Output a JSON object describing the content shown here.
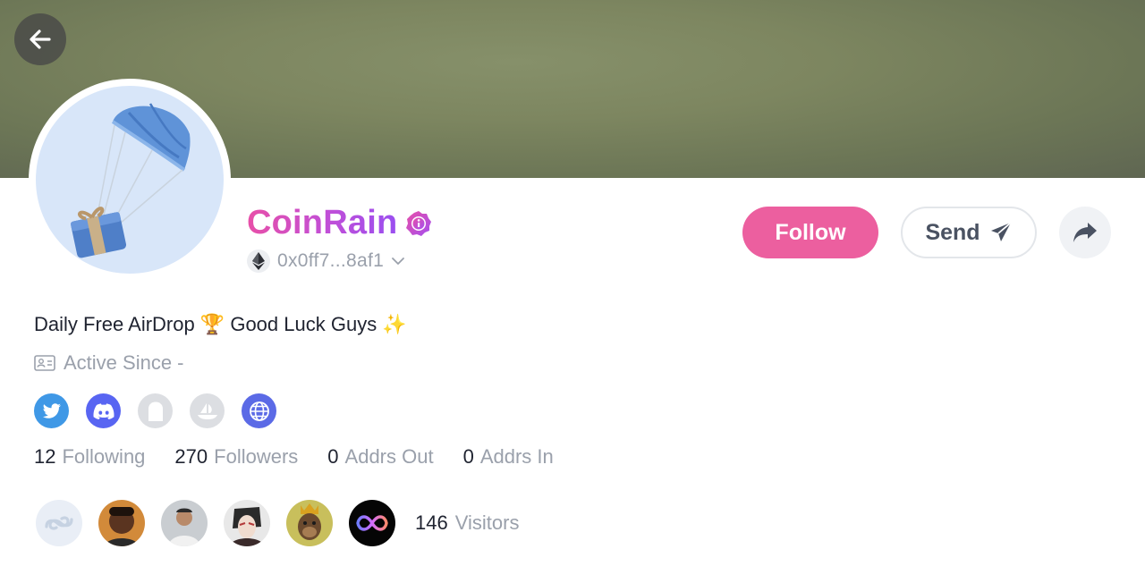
{
  "profile": {
    "name": "CoinRain",
    "address": "0x0ff7...8af1",
    "bio": "Daily Free AirDrop 🏆 Good Luck Guys ✨",
    "active_since": "Active Since -"
  },
  "actions": {
    "follow_label": "Follow",
    "send_label": "Send"
  },
  "socials": [
    {
      "icon": "twitter-icon",
      "color": "#3f98e6"
    },
    {
      "icon": "discord-icon",
      "color": "#5865f2"
    },
    {
      "icon": "ghost-icon",
      "color": "#dcdee2"
    },
    {
      "icon": "opensea-icon",
      "color": "#dcdee2"
    },
    {
      "icon": "globe-icon",
      "color": "#5b6ae6"
    }
  ],
  "stats": [
    {
      "value": "12",
      "label": "Following"
    },
    {
      "value": "270",
      "label": "Followers"
    },
    {
      "value": "0",
      "label": "Addrs Out"
    },
    {
      "value": "0",
      "label": "Addrs In"
    }
  ],
  "visitors": {
    "count": "146",
    "label": "Visitors"
  },
  "colors": {
    "accent": "#ec5f9f",
    "name_gradient_start": "#e84fa8",
    "name_gradient_end": "#9a4ff0"
  }
}
